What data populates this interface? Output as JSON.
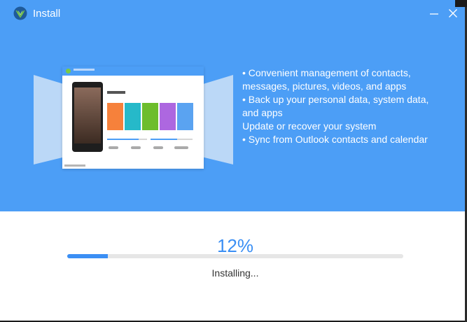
{
  "window": {
    "title": "Install"
  },
  "features": [
    "• Convenient management of contacts,",
    "messages, pictures, videos, and apps",
    "• Back up your personal data, system data,",
    "and apps",
    "Update or recover your system",
    "• Sync from Outlook contacts and calendar"
  ],
  "progress": {
    "percent_label": "12%",
    "fraction": 0.12,
    "status": "Installing..."
  },
  "colors": {
    "hero": "#4c9ef6",
    "accent": "#3b8ff4",
    "logo_green": "#7ac943"
  },
  "icons": {
    "logo": "app-logo-icon",
    "minimize": "minimize-icon",
    "close": "close-icon"
  }
}
